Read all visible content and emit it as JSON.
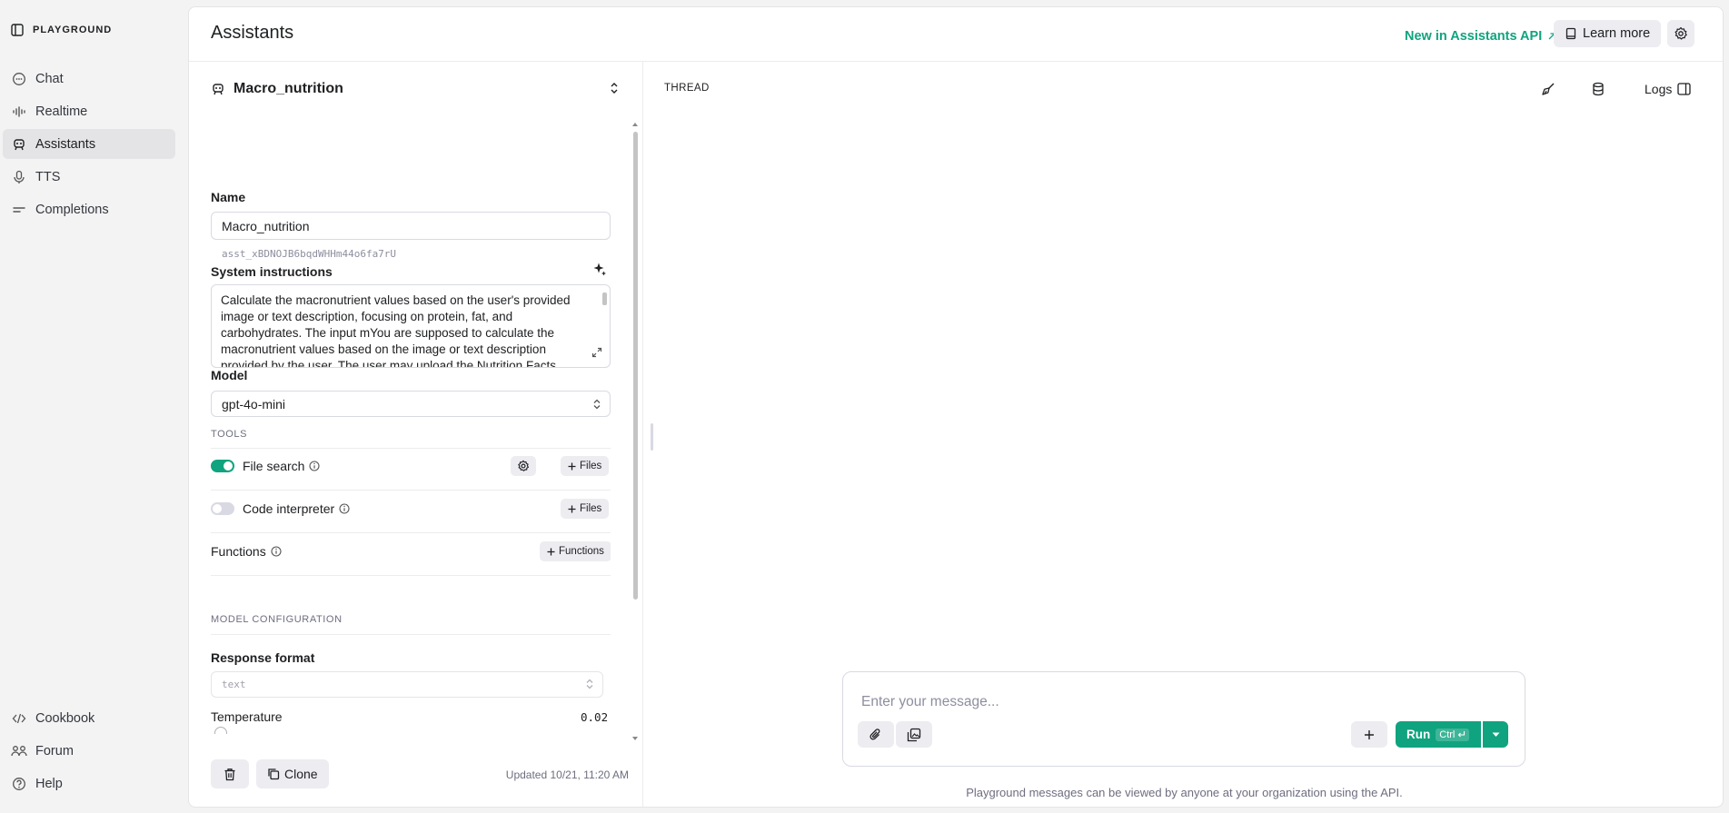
{
  "nav": {
    "brand": "PLAYGROUND",
    "items": [
      {
        "label": "Chat",
        "icon": "chat-bubble-icon"
      },
      {
        "label": "Realtime",
        "icon": "waveform-icon"
      },
      {
        "label": "Assistants",
        "icon": "robot-icon",
        "active": true
      },
      {
        "label": "TTS",
        "icon": "microphone-icon"
      },
      {
        "label": "Completions",
        "icon": "lines-icon"
      }
    ],
    "bottom": [
      {
        "label": "Cookbook",
        "icon": "code-icon"
      },
      {
        "label": "Forum",
        "icon": "people-icon"
      },
      {
        "label": "Help",
        "icon": "help-icon"
      }
    ]
  },
  "header": {
    "title": "Assistants",
    "new_link": "New in Assistants API",
    "learn_more": "Learn more"
  },
  "assistant": {
    "selected": "Macro_nutrition",
    "name_label": "Name",
    "name_value": "Macro_nutrition",
    "id": "asst_xBDNOJB6bqdWHHm44o6fa7rU",
    "instructions_label": "System instructions",
    "instructions": "Calculate the macronutrient values based on the user's provided image or text description, focusing on protein, fat, and carbohydrates. The input mYou are supposed to calculate the macronutrient values based on the image or text description provided by the user. The user may upload the Nutrition Facts",
    "model_label": "Model",
    "model_value": "gpt-4o-mini",
    "tools_heading": "TOOLS",
    "tools": {
      "file_search": {
        "label": "File search",
        "enabled": true,
        "files_label": "Files"
      },
      "code_interpreter": {
        "label": "Code interpreter",
        "enabled": false,
        "files_label": "Files"
      },
      "functions": {
        "label": "Functions",
        "add_label": "Functions"
      }
    },
    "model_config_heading": "MODEL CONFIGURATION",
    "response_format_label": "Response format",
    "response_format_value": "text",
    "temperature_label": "Temperature",
    "temperature_value": "0.02",
    "clone_label": "Clone",
    "updated": "Updated 10/21, 11:20 AM"
  },
  "thread": {
    "title": "THREAD",
    "logs_label": "Logs",
    "placeholder": "Enter your message...",
    "run_label": "Run",
    "run_shortcut": "Ctrl",
    "footnote": "Playground messages can be viewed by anyone at your organization using the API."
  },
  "colors": {
    "accent": "#10a37f",
    "chip_bg": "#ececf1",
    "border": "#d9d9e3"
  }
}
